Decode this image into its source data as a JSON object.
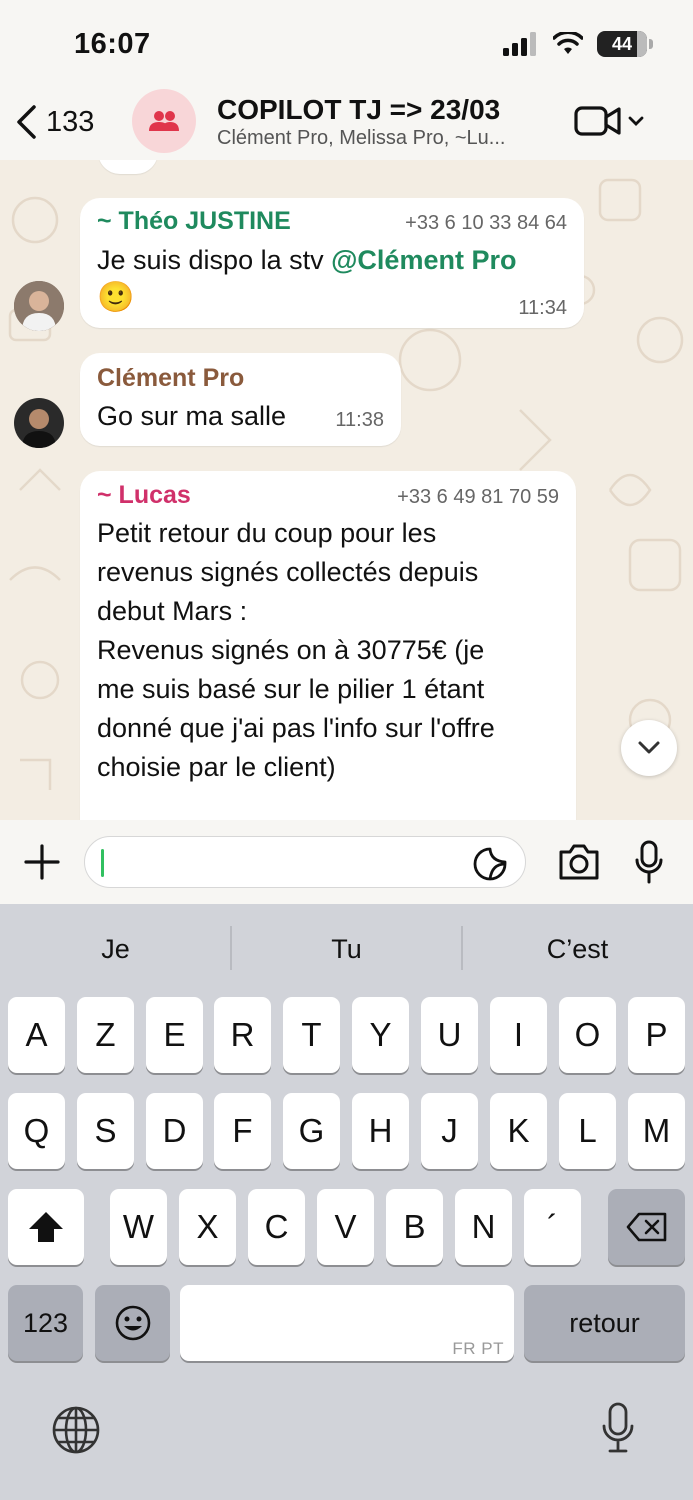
{
  "status_bar": {
    "time": "16:07",
    "battery": "44"
  },
  "header": {
    "back_count": "133",
    "title": "COPILOT TJ => 23/03",
    "subtitle": "Clément Pro, Melissa Pro, ~Lu..."
  },
  "messages": [
    {
      "sender": "~ Théo JUSTINE",
      "phone": "+33 6 10 33 84 64",
      "text_prefix": "Je suis dispo la stv ",
      "mention": "@Clément Pro",
      "emoji": "🙂",
      "time": "11:34",
      "sender_color": "#1f8a5e"
    },
    {
      "sender": "Clément Pro",
      "text": "Go sur ma salle",
      "time": "11:38",
      "sender_color": "#8a5a3c"
    },
    {
      "sender": "~ Lucas",
      "phone": "+33 6 49 81 70 59",
      "lines": [
        "Petit retour du coup pour les",
        "revenus signés collectés depuis",
        "debut Mars :",
        "Revenus signés on à 30775€ (je",
        "me suis basé sur le pilier 1 étant",
        "donné que j'ai pas l'info sur l'offre",
        "choisie par le client)"
      ],
      "sender_color": "#d0306a"
    }
  ],
  "compose": {
    "value": ""
  },
  "keyboard": {
    "suggestions": [
      "Je",
      "Tu",
      "C’est"
    ],
    "row1": [
      "A",
      "Z",
      "E",
      "R",
      "T",
      "Y",
      "U",
      "I",
      "O",
      "P"
    ],
    "row2": [
      "Q",
      "S",
      "D",
      "F",
      "G",
      "H",
      "J",
      "K",
      "L",
      "M"
    ],
    "row3": [
      "W",
      "X",
      "C",
      "V",
      "B",
      "N",
      "´"
    ],
    "numbers_label": "123",
    "space_hint": "FR PT",
    "return_label": "retour"
  },
  "colors": {
    "mention": "#1f8a5e",
    "accent_green": "#31c060",
    "group_icon": "#e0354b"
  }
}
